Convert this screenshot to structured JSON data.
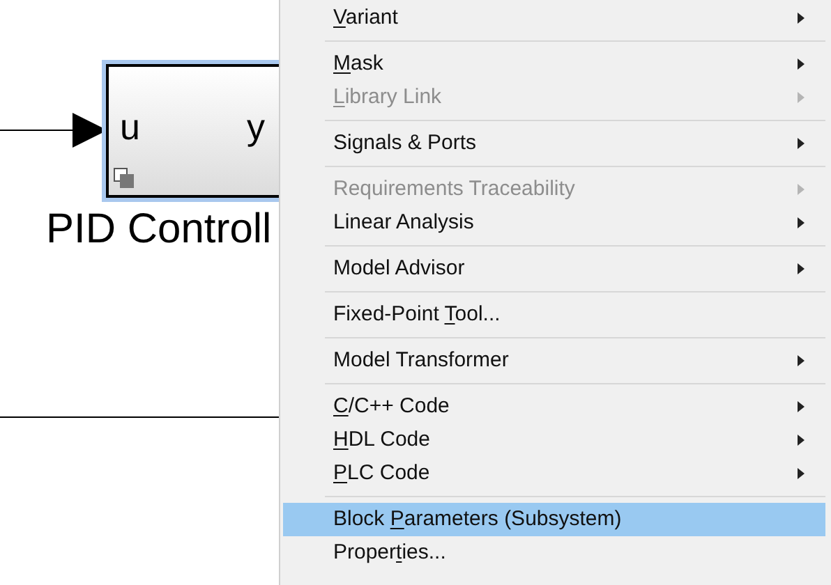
{
  "diagram": {
    "block": {
      "input_port": "u",
      "output_port": "y",
      "selected": true,
      "label": "PID Controll"
    }
  },
  "context_menu": {
    "items": [
      {
        "kind": "item",
        "label": [
          {
            "text": "V",
            "underlined": true
          },
          {
            "text": "ariant",
            "underlined": false
          }
        ],
        "disabled": false,
        "submenu": true,
        "selected": false
      },
      {
        "kind": "separator"
      },
      {
        "kind": "item",
        "label": [
          {
            "text": "M",
            "underlined": true
          },
          {
            "text": "ask",
            "underlined": false
          }
        ],
        "disabled": false,
        "submenu": true,
        "selected": false
      },
      {
        "kind": "item",
        "label": [
          {
            "text": "L",
            "underlined": true
          },
          {
            "text": "ibrary Link",
            "underlined": false
          }
        ],
        "disabled": true,
        "submenu": true,
        "selected": false
      },
      {
        "kind": "separator"
      },
      {
        "kind": "item",
        "label": [
          {
            "text": "Signals & Ports",
            "underlined": false
          }
        ],
        "disabled": false,
        "submenu": true,
        "selected": false
      },
      {
        "kind": "separator"
      },
      {
        "kind": "item",
        "label": [
          {
            "text": "Requirements Traceability",
            "underlined": false
          }
        ],
        "disabled": true,
        "submenu": true,
        "selected": false
      },
      {
        "kind": "item",
        "label": [
          {
            "text": "Linear Analysis",
            "underlined": false
          }
        ],
        "disabled": false,
        "submenu": true,
        "selected": false
      },
      {
        "kind": "separator"
      },
      {
        "kind": "item",
        "label": [
          {
            "text": "Model Advisor",
            "underlined": false
          }
        ],
        "disabled": false,
        "submenu": true,
        "selected": false
      },
      {
        "kind": "separator"
      },
      {
        "kind": "item",
        "label": [
          {
            "text": "Fixed-Point ",
            "underlined": false
          },
          {
            "text": "T",
            "underlined": true
          },
          {
            "text": "ool...",
            "underlined": false
          }
        ],
        "disabled": false,
        "submenu": false,
        "selected": false
      },
      {
        "kind": "separator"
      },
      {
        "kind": "item",
        "label": [
          {
            "text": "Model Transformer",
            "underlined": false
          }
        ],
        "disabled": false,
        "submenu": true,
        "selected": false
      },
      {
        "kind": "separator"
      },
      {
        "kind": "item",
        "label": [
          {
            "text": "C",
            "underlined": true
          },
          {
            "text": "/C++ Code",
            "underlined": false
          }
        ],
        "disabled": false,
        "submenu": true,
        "selected": false
      },
      {
        "kind": "item",
        "label": [
          {
            "text": "H",
            "underlined": true
          },
          {
            "text": "DL Code",
            "underlined": false
          }
        ],
        "disabled": false,
        "submenu": true,
        "selected": false
      },
      {
        "kind": "item",
        "label": [
          {
            "text": "P",
            "underlined": true
          },
          {
            "text": "LC Code",
            "underlined": false
          }
        ],
        "disabled": false,
        "submenu": true,
        "selected": false
      },
      {
        "kind": "separator"
      },
      {
        "kind": "item",
        "label": [
          {
            "text": "Block ",
            "underlined": false
          },
          {
            "text": "P",
            "underlined": true
          },
          {
            "text": "arameters (Subsystem)",
            "underlined": false
          }
        ],
        "disabled": false,
        "submenu": false,
        "selected": true
      },
      {
        "kind": "item",
        "label": [
          {
            "text": "Proper",
            "underlined": false
          },
          {
            "text": "t",
            "underlined": true
          },
          {
            "text": "ies...",
            "underlined": false
          }
        ],
        "disabled": false,
        "submenu": false,
        "selected": false
      }
    ]
  }
}
